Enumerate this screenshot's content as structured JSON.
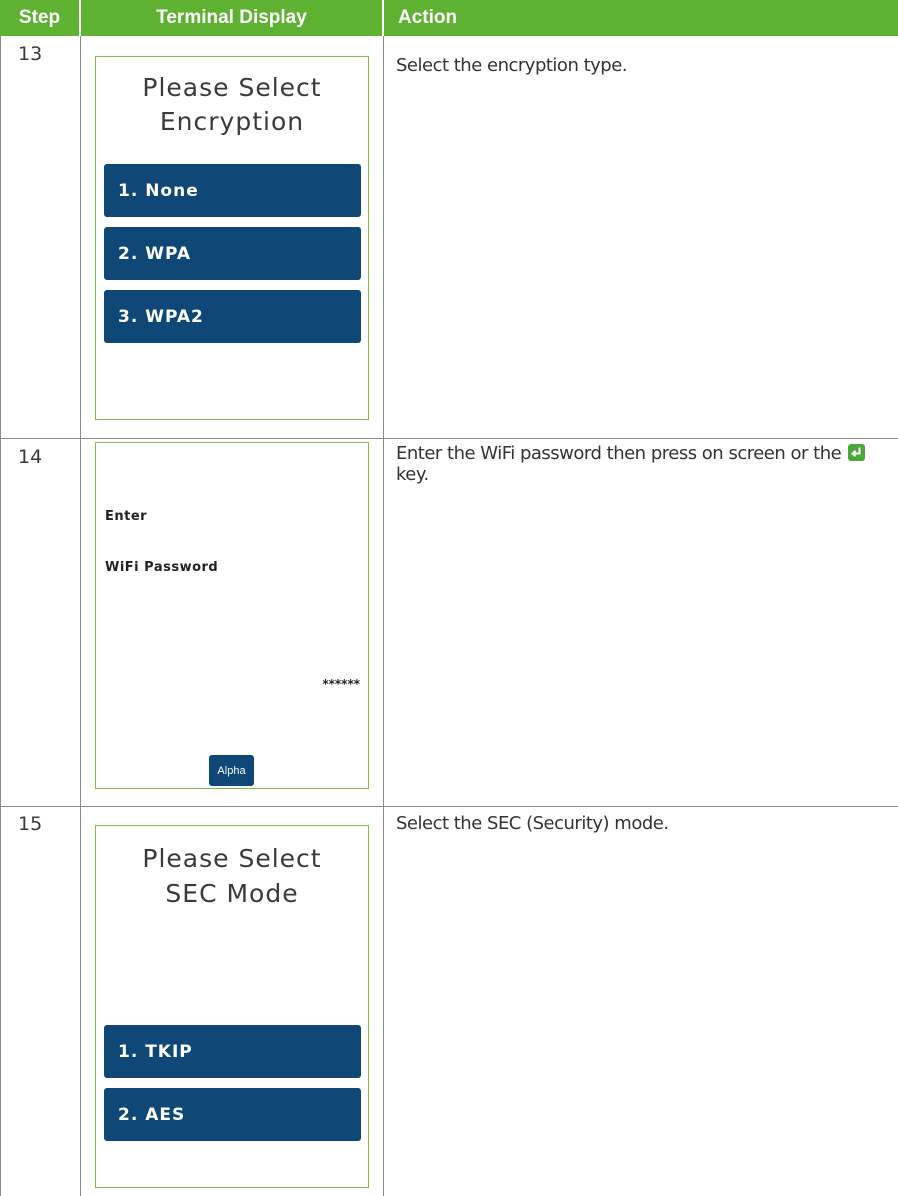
{
  "table": {
    "headers": {
      "step": "Step",
      "terminal": "Terminal Display",
      "action": "Action"
    },
    "rows": [
      {
        "step": "13",
        "screen": {
          "title_line1": "Please Select",
          "title_line2": "Encryption",
          "options": [
            "1. None",
            "2. WPA",
            "3. WPA2"
          ]
        },
        "action": "Select the encryption type."
      },
      {
        "step": "14",
        "screen": {
          "prompt_line1": "Enter",
          "prompt_line2": "WiFi Password",
          "masked_value": "******",
          "button_label": "Alpha"
        },
        "action_before": "Enter the WiFi password then press on screen or the",
        "action_after": "key.",
        "action_icon": "enter-key-icon"
      },
      {
        "step": "15",
        "screen": {
          "title_line1": "Please Select",
          "title_line2": "SEC Mode",
          "options": [
            "1. TKIP",
            "2. AES"
          ]
        },
        "action": "Select the SEC (Security) mode."
      }
    ]
  },
  "colors": {
    "header_bg": "#5fb132",
    "button_bg": "#0f4777",
    "screen_border": "#7cbf4a",
    "enter_key": "#4aa83a"
  }
}
